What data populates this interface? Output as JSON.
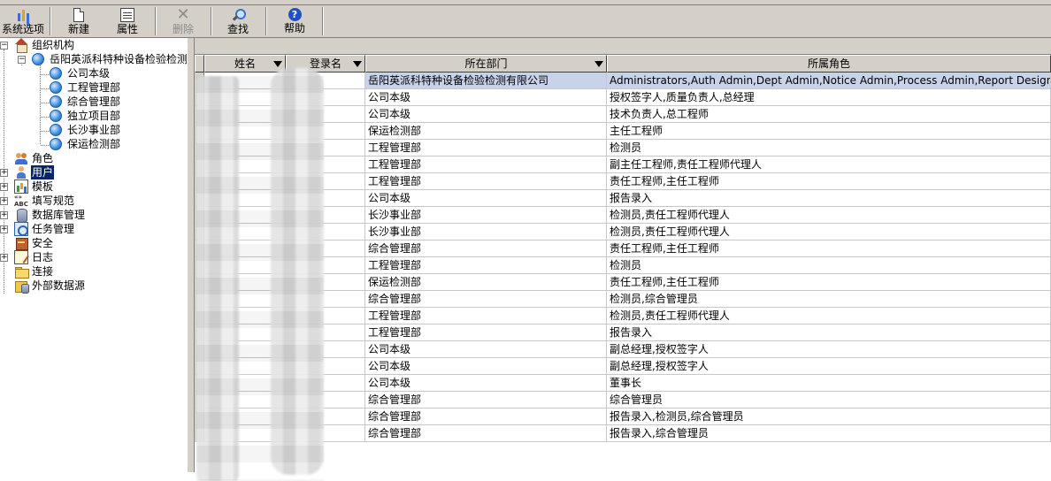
{
  "toolbar": {
    "buttons": [
      {
        "label": "系统选项",
        "icon": "system-options-icon",
        "enabled": true
      },
      {
        "label": "新建",
        "icon": "new-document-icon",
        "enabled": true
      },
      {
        "label": "属性",
        "icon": "properties-icon",
        "enabled": true
      },
      {
        "label": "删除",
        "icon": "delete-icon",
        "enabled": false
      },
      {
        "label": "查找",
        "icon": "find-icon",
        "enabled": true
      },
      {
        "label": "帮助",
        "icon": "help-icon",
        "enabled": true
      }
    ]
  },
  "tree": {
    "root": "组织机构",
    "company": "岳阳英派科特种设备检验检测",
    "departments": [
      "公司本级",
      "工程管理部",
      "综合管理部",
      "独立项目部",
      "长沙事业部",
      "保运检测部"
    ],
    "nodes": [
      {
        "label": "角色",
        "icon": "role-icon",
        "selected": false
      },
      {
        "label": "用户",
        "icon": "user-icon",
        "selected": true
      },
      {
        "label": "模板",
        "icon": "template-icon",
        "selected": false
      },
      {
        "label": "填写规范",
        "icon": "abc-icon",
        "selected": false
      },
      {
        "label": "数据库管理",
        "icon": "database-icon",
        "selected": false
      },
      {
        "label": "任务管理",
        "icon": "task-icon",
        "selected": false
      },
      {
        "label": "安全",
        "icon": "security-icon",
        "selected": false
      },
      {
        "label": "日志",
        "icon": "log-icon",
        "selected": false
      },
      {
        "label": "连接",
        "icon": "folder-icon",
        "selected": false
      },
      {
        "label": "外部数据源",
        "icon": "external-datasource-icon",
        "selected": false
      }
    ]
  },
  "grid": {
    "columns": [
      "姓名",
      "登录名",
      "所在部门",
      "所属角色"
    ],
    "rows": [
      {
        "dept": "岳阳英派科特种设备检验检测有限公司",
        "roles": "Administrators,Auth Admin,Dept Admin,Notice Admin,Process Admin,Report Designers,Report Owners"
      },
      {
        "dept": "公司本级",
        "roles": "授权签字人,质量负责人,总经理"
      },
      {
        "dept": "公司本级",
        "roles": "技术负责人,总工程师"
      },
      {
        "dept": "保运检测部",
        "roles": "主任工程师"
      },
      {
        "dept": "工程管理部",
        "roles": "检测员"
      },
      {
        "dept": "工程管理部",
        "roles": "副主任工程师,责任工程师代理人"
      },
      {
        "dept": "工程管理部",
        "roles": "责任工程师,主任工程师"
      },
      {
        "dept": "公司本级",
        "roles": "报告录入"
      },
      {
        "dept": "长沙事业部",
        "roles": "检测员,责任工程师代理人"
      },
      {
        "dept": "长沙事业部",
        "roles": "检测员,责任工程师代理人"
      },
      {
        "dept": "综合管理部",
        "roles": "责任工程师,主任工程师"
      },
      {
        "dept": "工程管理部",
        "roles": "检测员"
      },
      {
        "dept": "保运检测部",
        "roles": "责任工程师,主任工程师"
      },
      {
        "dept": "综合管理部",
        "roles": "检测员,综合管理员"
      },
      {
        "dept": "工程管理部",
        "roles": "检测员,责任工程师代理人"
      },
      {
        "dept": "工程管理部",
        "roles": "报告录入"
      },
      {
        "dept": "公司本级",
        "roles": "副总经理,授权签字人"
      },
      {
        "dept": "公司本级",
        "roles": "副总经理,授权签字人"
      },
      {
        "dept": "公司本级",
        "roles": "董事长"
      },
      {
        "dept": "综合管理部",
        "roles": "综合管理员"
      },
      {
        "dept": "综合管理部",
        "roles": "报告录入,检测员,综合管理员"
      },
      {
        "dept": "综合管理部",
        "roles": "报告录入,综合管理员"
      }
    ]
  }
}
